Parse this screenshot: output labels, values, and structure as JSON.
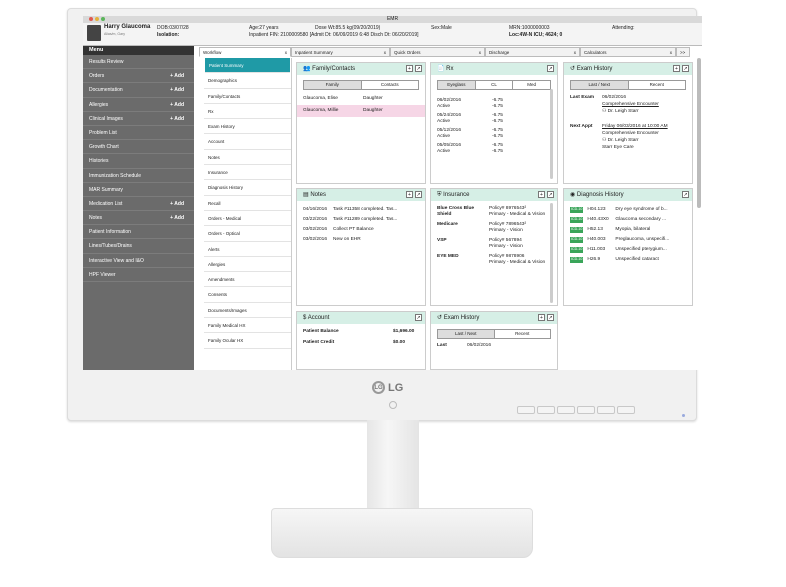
{
  "window": {
    "title": "EMR"
  },
  "patient": {
    "name": "Harry Glaucoma",
    "alias": "Alias/m, Gary",
    "dob": "DOB:03/07/28",
    "isolation": "Isolation:",
    "age": "Age:27 years",
    "fin": "Inpatient FIN: 2100009580 [Admit Dt: 06/09/2019 6:48 Disch Dt: 06/20/2019]",
    "dose": "Dose Wt:85.5 kg(09/20/2019)",
    "sex": "Sex:Male",
    "mrn": "MRN:1000000003",
    "loc": "Loc:4W-N ICU; 4624; 0",
    "attending": "Attending:"
  },
  "menu": {
    "header": "Menu",
    "items": [
      {
        "label": "Results Review",
        "add": ""
      },
      {
        "label": "Orders",
        "add": "+ Add"
      },
      {
        "label": "Documentation",
        "add": "+ Add"
      },
      {
        "label": "Allergies",
        "add": "+ Add"
      },
      {
        "label": "Clinical Images",
        "add": "+ Add"
      },
      {
        "label": "Problem List",
        "add": ""
      },
      {
        "label": "Growth Chart",
        "add": ""
      },
      {
        "label": "Histories",
        "add": ""
      },
      {
        "label": "Immunization Schedule",
        "add": ""
      },
      {
        "label": "MAR Summary",
        "add": ""
      },
      {
        "label": "Medication List",
        "add": "+ Add"
      },
      {
        "label": "Notes",
        "add": "+ Add"
      },
      {
        "label": "Patient Information",
        "add": ""
      },
      {
        "label": "Lines/Tubes/Drains",
        "add": ""
      },
      {
        "label": "Interactive View and I&O",
        "add": ""
      },
      {
        "label": "HPF Viewer",
        "add": ""
      }
    ]
  },
  "tabs": [
    {
      "label": "Workflow",
      "x": "x"
    },
    {
      "label": "Inpatient Summary",
      "x": "x"
    },
    {
      "label": "Quick Orders",
      "x": "x"
    },
    {
      "label": "Discharge",
      "x": "x"
    },
    {
      "label": "Calculators",
      "x": "x"
    },
    {
      "label": ">>",
      "x": ""
    }
  ],
  "workflow": [
    "Patient Summary",
    "Demographics",
    "Family/Contacts",
    "Rx",
    "Exam History",
    "Account",
    "Notes",
    "Insurance",
    "Diagnosis History",
    "Recall",
    "Orders - Medical",
    "Orders - Optical",
    "Alerts",
    "Allergies",
    "Amendments",
    "Consents",
    "Documents/Images",
    "Family Medical HX",
    "Family Ocular HX"
  ],
  "family": {
    "title": "Family/Contacts",
    "tabs": [
      "Family",
      "Contacts"
    ],
    "rows": [
      [
        "Glaucoma, Elise",
        "Daughter"
      ],
      [
        "Glaucoma, Millie",
        "Daughter"
      ]
    ]
  },
  "rx": {
    "title": "Rx",
    "tabs": [
      "Eyeglass",
      "CL",
      "Med"
    ],
    "rows": [
      [
        "06/02/2016",
        "-6.75"
      ],
      [
        "Active",
        "-6.75"
      ],
      [
        "05/24/2016",
        "-6.75"
      ],
      [
        "Active",
        "-6.75"
      ],
      [
        "05/12/2016",
        "-6.75"
      ],
      [
        "Active",
        "-6.75"
      ],
      [
        "05/05/2016",
        "-6.75"
      ],
      [
        "Active",
        "-6.75"
      ]
    ]
  },
  "exam": {
    "title": "Exam History",
    "tabs": [
      "Last / Next",
      "Recent"
    ],
    "last_label": "Last Exam",
    "last_date": "06/02/2016",
    "last_type": "Comprehensive Encounter",
    "last_dr": "Dr. Leigh Starr",
    "next_label": "Next Appt",
    "next_date": "Friday 06/03/2016 at 10:00 AM",
    "next_type": "Comprehensive Encounter",
    "next_dr": "Dr. Leigh Starr",
    "next_loc": "Starr Eye Care"
  },
  "notes": {
    "title": "Notes",
    "rows": [
      [
        "04/16/2016",
        "Task #11358 completed. Tas..."
      ],
      [
        "03/22/2016",
        "Task #11289 completed. Tas..."
      ],
      [
        "03/02/2016",
        "Collect PT Balance"
      ],
      [
        "03/02/2016",
        "New on EHR"
      ]
    ]
  },
  "insurance": {
    "title": "Insurance",
    "rows": [
      {
        "name": "Blue Cross Blue Shield",
        "policy": "Policy# 8976543²",
        "detail": "Primary - Medical & Vision"
      },
      {
        "name": "Medicare",
        "policy": "Policy# 7896543²",
        "detail": "Primary - Vision"
      },
      {
        "name": "VSP",
        "policy": "Policy# 567894",
        "detail": "Primary - Vision"
      },
      {
        "name": "EYE MED",
        "policy": "Policy# 9878906",
        "detail": "Primary - Medical & Vision"
      }
    ]
  },
  "diagnosis": {
    "title": "Diagnosis History",
    "badge": "ICD-10",
    "rows": [
      [
        "H04.123",
        "Dry eye syndrome of b..."
      ],
      [
        "H40.43X0",
        "Glaucoma secondary ..."
      ],
      [
        "H52.13",
        "Myopia, bilateral"
      ],
      [
        "H40.003",
        "Preglaucoma, unspecifi..."
      ],
      [
        "H11.003",
        "Unspecified pterygium..."
      ],
      [
        "H26.9",
        "Unspecified cataract"
      ]
    ]
  },
  "account": {
    "title": "Account",
    "rows": [
      [
        "Patient Balance",
        "$1,696.00"
      ],
      [
        "Patient Credit",
        "$0.00"
      ]
    ]
  },
  "exam2": {
    "title": "Exam History",
    "tabs": [
      "Last / Next",
      "Recent"
    ],
    "last_label": "Last",
    "last_date": "06/02/2016"
  },
  "brand": {
    "logo": "LG",
    "logo_mark": "LG"
  }
}
